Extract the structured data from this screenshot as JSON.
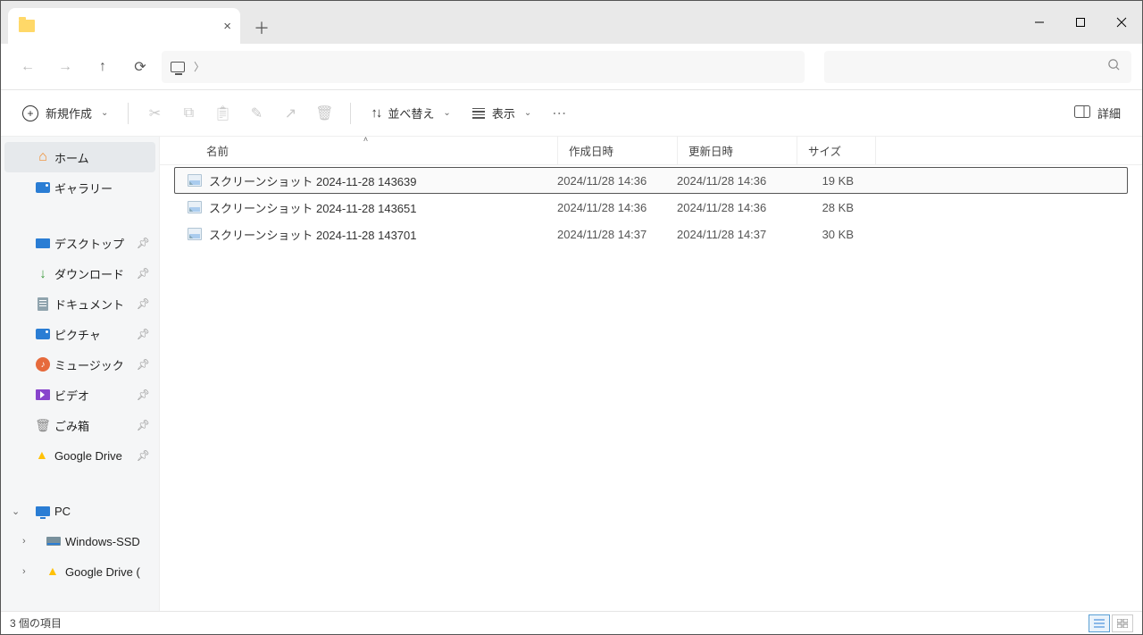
{
  "tab": {
    "title": ""
  },
  "toolbar": {
    "new": "新規作成",
    "sort": "並べ替え",
    "view": "表示",
    "details": "詳細"
  },
  "sidebar": {
    "home": "ホーム",
    "gallery": "ギャラリー",
    "desktop": "デスクトップ",
    "downloads": "ダウンロード",
    "documents": "ドキュメント",
    "pictures": "ピクチャ",
    "music": "ミュージック",
    "video": "ビデオ",
    "trash": "ごみ箱",
    "gdrive": "Google Drive",
    "pc": "PC",
    "ssd": "Windows-SSD",
    "gdrive2": "Google Drive ("
  },
  "columns": {
    "name": "名前",
    "created": "作成日時",
    "modified": "更新日時",
    "size": "サイズ"
  },
  "files": [
    {
      "name": "スクリーンショット 2024-11-28 143639",
      "created": "2024/11/28 14:36",
      "modified": "2024/11/28 14:36",
      "size": "19 KB",
      "selected": true
    },
    {
      "name": "スクリーンショット 2024-11-28 143651",
      "created": "2024/11/28 14:36",
      "modified": "2024/11/28 14:36",
      "size": "28 KB",
      "selected": false
    },
    {
      "name": "スクリーンショット 2024-11-28 143701",
      "created": "2024/11/28 14:37",
      "modified": "2024/11/28 14:37",
      "size": "30 KB",
      "selected": false
    }
  ],
  "status": {
    "text": "3 個の項目"
  }
}
